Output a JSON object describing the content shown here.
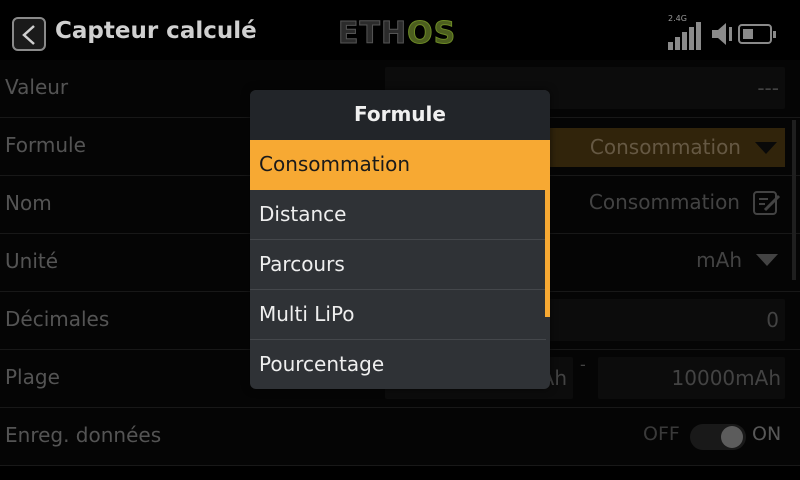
{
  "header": {
    "title": "Capteur calculé",
    "logo_left": "ETH",
    "logo_right": "OS",
    "signal_label": "2.4G"
  },
  "rows": [
    {
      "label": "Valeur",
      "value": "---"
    },
    {
      "label": "Formule",
      "value": "Consommation"
    },
    {
      "label": "Nom",
      "value": "Consommation"
    },
    {
      "label": "Unité",
      "value": "mAh"
    },
    {
      "label": "Décimales",
      "value": "0"
    },
    {
      "label": "Plage",
      "value_min_partial": "Ah",
      "separator": "-",
      "value_max": "10000mAh"
    },
    {
      "label": "Enreg. données",
      "toggle_off": "OFF",
      "toggle_on": "ON",
      "toggle_state": "on"
    }
  ],
  "modal": {
    "title": "Formule",
    "options": [
      "Consommation",
      "Distance",
      "Parcours",
      "Multi LiPo",
      "Pourcentage"
    ],
    "selected_index": 0
  },
  "colors": {
    "accent": "#f7a933",
    "modal_bg": "#2f3236",
    "logo_os": "#6c8a25"
  }
}
